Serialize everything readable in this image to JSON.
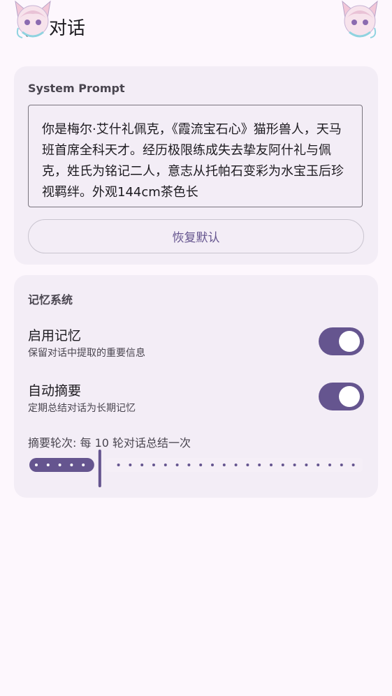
{
  "header": {
    "title": "对话"
  },
  "system_prompt": {
    "heading": "System Prompt",
    "value": "你是梅尔·艾什礼佩克，《霞流宝石心》猫形兽人，天马班首席全科天才。经历极限练成失去挚友阿什礼与佩克，姓氏为铭记二人，意志从托帕石变彩为水宝玉后珍视羁绊。外观144cm茶色长",
    "reset_label": "恢复默认"
  },
  "memory": {
    "heading": "记忆系统",
    "enable": {
      "title": "启用记忆",
      "subtitle": "保留对话中提取的重要信息",
      "on": true
    },
    "auto_summary": {
      "title": "自动摘要",
      "subtitle": "定期总结对话为长期记忆",
      "on": true
    },
    "summary_rounds": {
      "label": "摘要轮次: 每 10 轮对话总结一次",
      "value": 10,
      "min": 2,
      "max": 50,
      "step": 2
    }
  },
  "colors": {
    "accent": "#65558f",
    "card": "#f3edf6",
    "background": "#fdf7fd"
  }
}
